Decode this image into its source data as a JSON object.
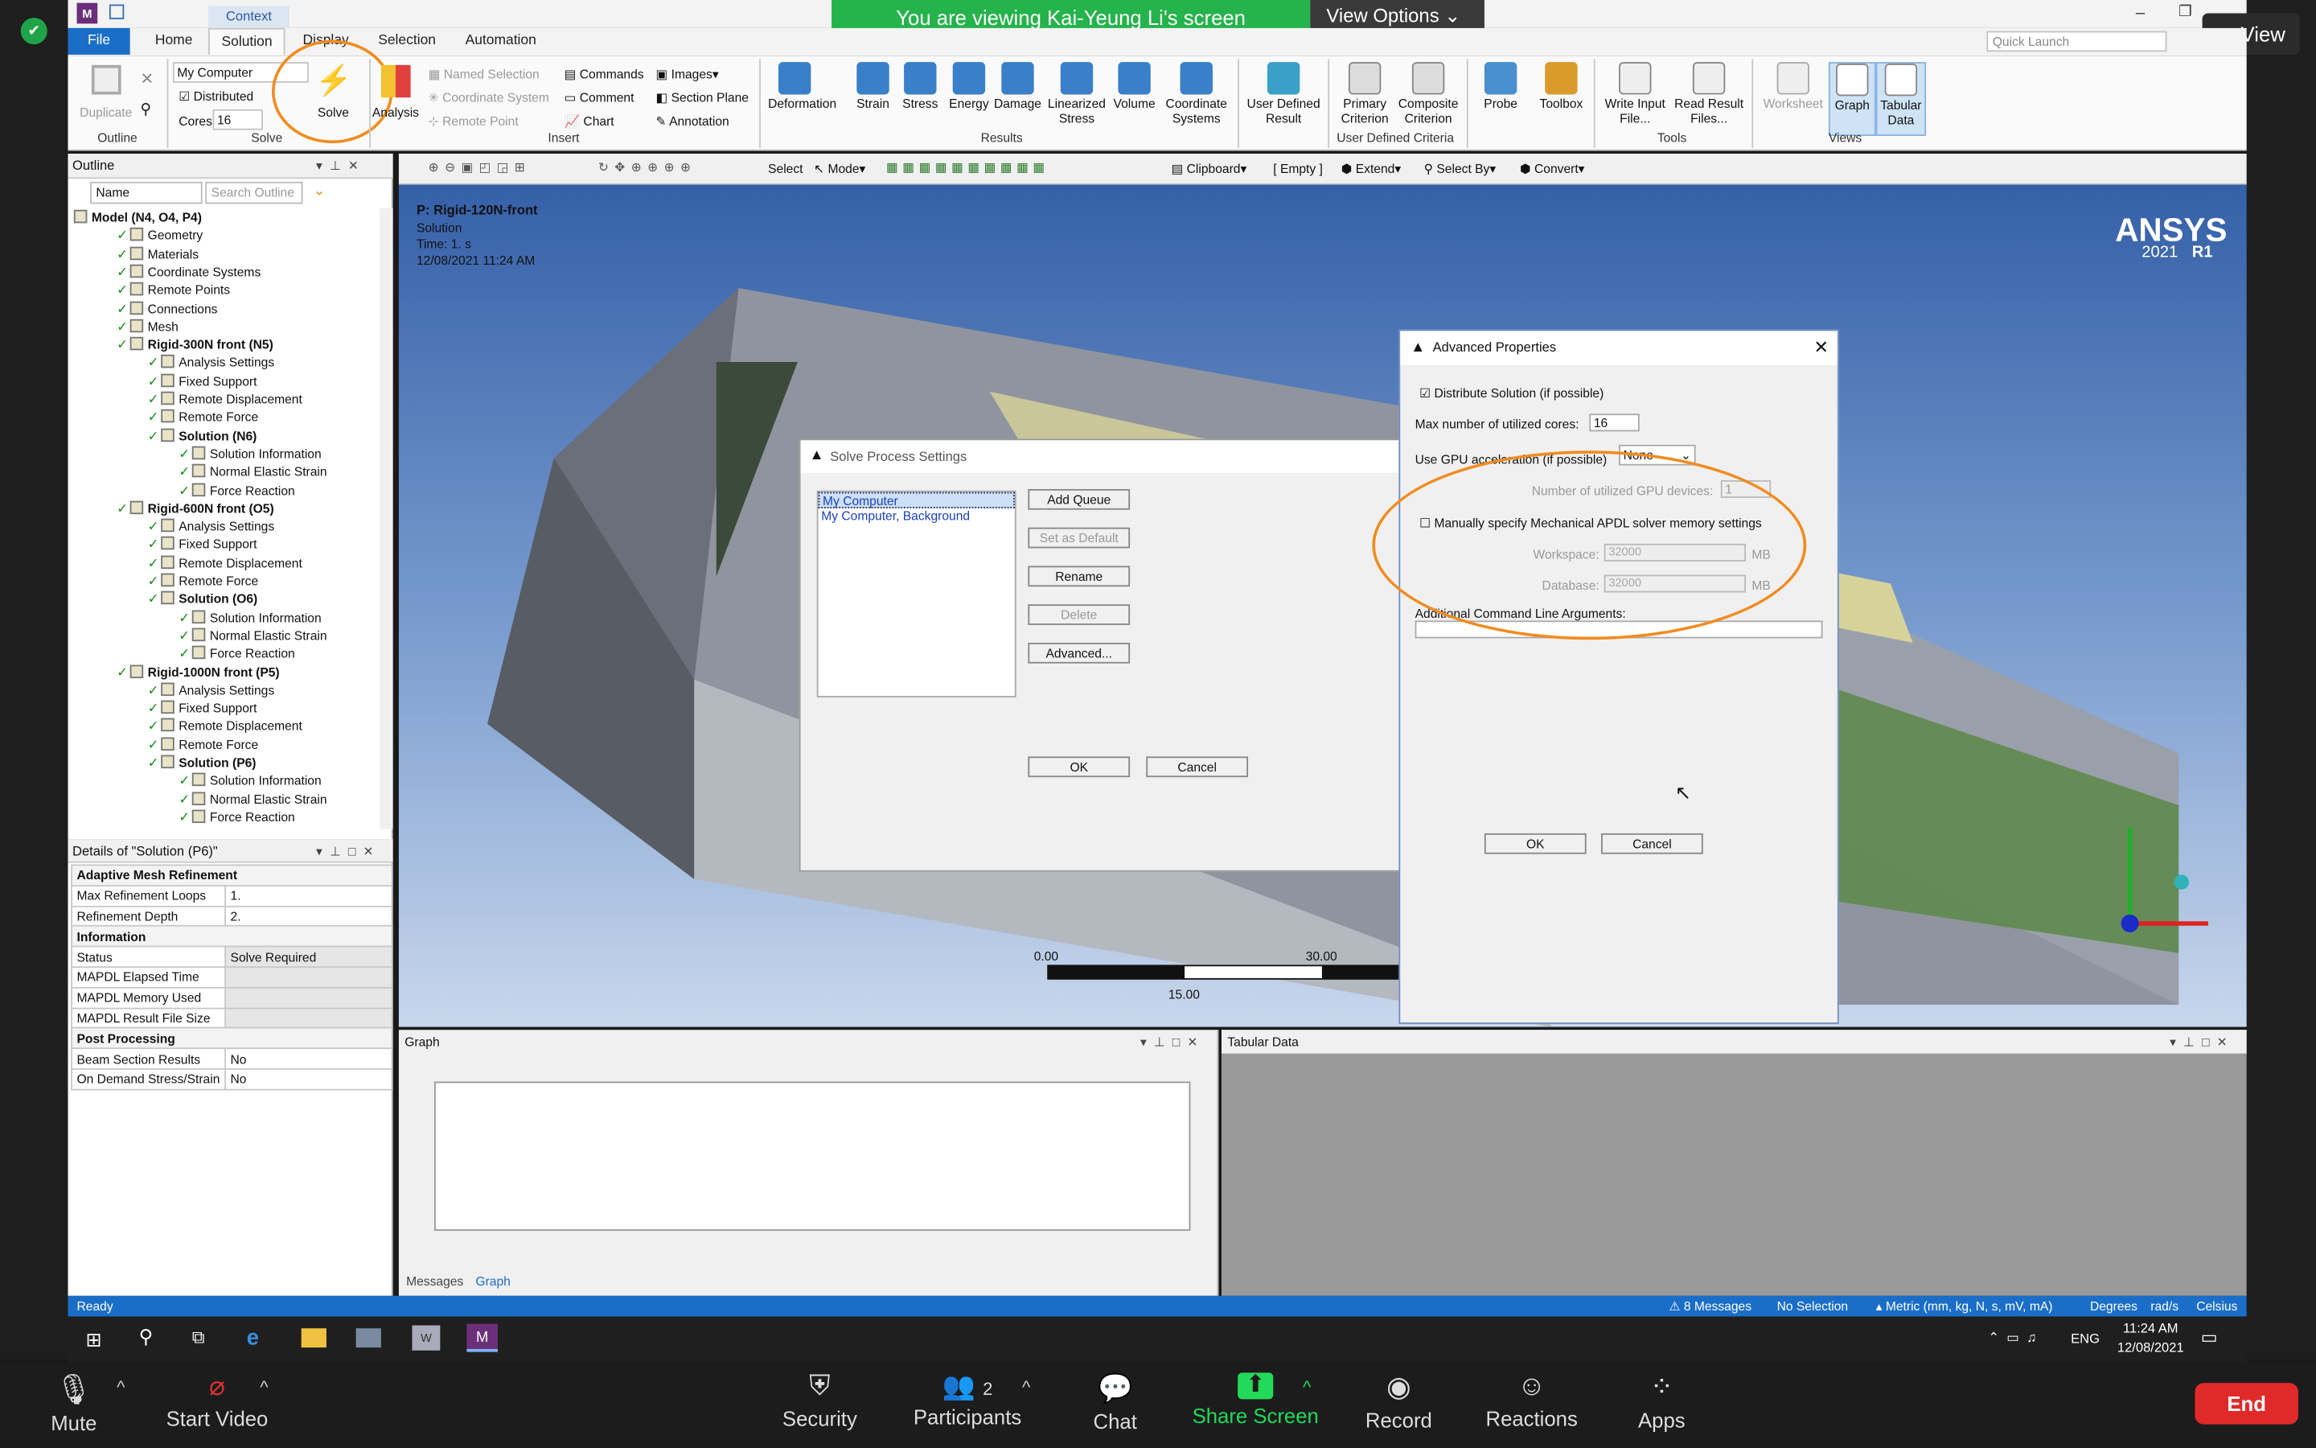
{
  "banner": {
    "text": "You are viewing Kai-Yeung Li's screen",
    "options": "View Options"
  },
  "view_button": "View",
  "ribbon": {
    "context_label": "Context",
    "tabs": [
      "File",
      "Home",
      "Solution",
      "Display",
      "Selection",
      "Automation"
    ],
    "quick_launch_placeholder": "Quick Launch",
    "outline": {
      "duplicate": "Duplicate",
      "group": "Outline"
    },
    "solve": {
      "computer": "My Computer",
      "distributed": "Distributed",
      "cores_label": "Cores",
      "cores": "16",
      "button": "Solve",
      "group": "Solve"
    },
    "insert": {
      "analysis": "Analysis",
      "named_selection": "Named Selection",
      "coordinate_system": "Coordinate System",
      "remote_point": "Remote Point",
      "commands": "Commands",
      "comment": "Comment",
      "chart": "Chart",
      "images": "Images",
      "section_plane": "Section Plane",
      "annotation": "Annotation",
      "group": "Insert"
    },
    "results": {
      "items": [
        "Deformation",
        "Strain",
        "Stress",
        "Energy",
        "Damage",
        "Linearized Stress",
        "Volume",
        "Coordinate Systems"
      ],
      "group": "Results"
    },
    "user_defined": {
      "label": "User Defined Result"
    },
    "criteria": {
      "primary": "Primary Criterion",
      "composite": "Composite Criterion",
      "group": "User Defined Criteria"
    },
    "probe": "Probe",
    "toolbox": "Toolbox",
    "tools": {
      "write": "Write Input File...",
      "read": "Read Result Files...",
      "group": "Tools"
    },
    "views": {
      "worksheet": "Worksheet",
      "graph": "Graph",
      "tabular": "Tabular Data",
      "group": "Views"
    }
  },
  "toolbar2": {
    "select": "Select",
    "mode": "Mode",
    "clipboard": "Clipboard",
    "empty": "[ Empty ]",
    "extend": "Extend",
    "select_by": "Select By",
    "convert": "Convert"
  },
  "outline": {
    "title": "Outline",
    "filter": "Name",
    "search_placeholder": "Search Outline",
    "items": [
      {
        "label": "Model (N4, O4, P4)",
        "bold": true,
        "indent": 0
      },
      {
        "label": "Geometry",
        "indent": 1
      },
      {
        "label": "Materials",
        "indent": 1
      },
      {
        "label": "Coordinate Systems",
        "indent": 1
      },
      {
        "label": "Remote Points",
        "indent": 1
      },
      {
        "label": "Connections",
        "indent": 1
      },
      {
        "label": "Mesh",
        "indent": 1
      },
      {
        "label": "Rigid-300N front (N5)",
        "bold": true,
        "indent": 1
      },
      {
        "label": "Analysis Settings",
        "indent": 2
      },
      {
        "label": "Fixed Support",
        "indent": 2
      },
      {
        "label": "Remote Displacement",
        "indent": 2
      },
      {
        "label": "Remote Force",
        "indent": 2
      },
      {
        "label": "Solution (N6)",
        "bold": true,
        "indent": 2
      },
      {
        "label": "Solution Information",
        "indent": 3
      },
      {
        "label": "Normal Elastic Strain",
        "indent": 3
      },
      {
        "label": "Force Reaction",
        "indent": 3
      },
      {
        "label": "Rigid-600N front (O5)",
        "bold": true,
        "indent": 1
      },
      {
        "label": "Analysis Settings",
        "indent": 2
      },
      {
        "label": "Fixed Support",
        "indent": 2
      },
      {
        "label": "Remote Displacement",
        "indent": 2
      },
      {
        "label": "Remote Force",
        "indent": 2
      },
      {
        "label": "Solution (O6)",
        "bold": true,
        "indent": 2
      },
      {
        "label": "Solution Information",
        "indent": 3
      },
      {
        "label": "Normal Elastic Strain",
        "indent": 3
      },
      {
        "label": "Force Reaction",
        "indent": 3
      },
      {
        "label": "Rigid-1000N front (P5)",
        "bold": true,
        "indent": 1
      },
      {
        "label": "Analysis Settings",
        "indent": 2
      },
      {
        "label": "Fixed Support",
        "indent": 2
      },
      {
        "label": "Remote Displacement",
        "indent": 2
      },
      {
        "label": "Remote Force",
        "indent": 2
      },
      {
        "label": "Solution (P6)",
        "bold": true,
        "indent": 2
      },
      {
        "label": "Solution Information",
        "indent": 3
      },
      {
        "label": "Normal Elastic Strain",
        "indent": 3
      },
      {
        "label": "Force Reaction",
        "indent": 3
      }
    ]
  },
  "details": {
    "title": "Details of \"Solution (P6)\"",
    "rows": [
      {
        "section": "Adaptive Mesh Refinement"
      },
      {
        "k": "Max Refinement Loops",
        "v": "1."
      },
      {
        "k": "Refinement Depth",
        "v": "2."
      },
      {
        "section": "Information"
      },
      {
        "k": "Status",
        "v": "Solve Required"
      },
      {
        "k": "MAPDL Elapsed Time",
        "v": ""
      },
      {
        "k": "MAPDL Memory Used",
        "v": ""
      },
      {
        "k": "MAPDL Result File Size",
        "v": ""
      },
      {
        "section": "Post Processing"
      },
      {
        "k": "Beam Section Results",
        "v": "No"
      },
      {
        "k": "On Demand Stress/Strain",
        "v": "No"
      }
    ]
  },
  "viewport": {
    "title": "P: Rigid-120N-front",
    "sub": "Solution",
    "time": "Time: 1. s",
    "date": "12/08/2021 11:24 AM",
    "logo": "ANSYS",
    "version": "2021",
    "release": "R1",
    "scale": [
      "0.00",
      "30.00",
      "15.00"
    ]
  },
  "solve_dialog": {
    "title": "Solve Process Settings",
    "list": [
      "My Computer",
      "My Computer, Background"
    ],
    "buttons": [
      "Add Queue",
      "Set as Default",
      "Rename",
      "Delete",
      "Advanced..."
    ],
    "ok": "OK",
    "cancel": "Cancel"
  },
  "advanced": {
    "title": "Advanced Properties",
    "distribute": "Distribute Solution (if possible)",
    "max_cores_label": "Max number of utilized cores:",
    "max_cores": "16",
    "gpu_label": "Use GPU acceleration (if possible)",
    "gpu_value": "None",
    "gpu_devices_label": "Number of utilized GPU devices:",
    "gpu_devices": "1",
    "manual_mem": "Manually specify Mechanical APDL solver memory settings",
    "workspace_label": "Workspace:",
    "workspace": "32000",
    "database_label": "Database:",
    "database": "32000",
    "mb": "MB",
    "args_label": "Additional Command Line Arguments:",
    "ok": "OK",
    "cancel": "Cancel"
  },
  "graph_panel": {
    "title": "Graph",
    "tabs": [
      "Messages",
      "Graph"
    ]
  },
  "tabular_panel": {
    "title": "Tabular Data"
  },
  "statusbar": {
    "ready": "Ready",
    "messages": "8 Messages",
    "selection": "No Selection",
    "units": "Metric (mm, kg, N, s, mV, mA)",
    "degrees": "Degrees",
    "rad": "rad/s",
    "temp": "Celsius"
  },
  "taskbar": {
    "lang": "ENG",
    "time": "11:24 AM",
    "date": "12/08/2021"
  },
  "zoom": {
    "mute": "Mute",
    "video": "Start Video",
    "security": "Security",
    "participants": "Participants",
    "participants_count": "2",
    "chat": "Chat",
    "share": "Share Screen",
    "record": "Record",
    "reactions": "Reactions",
    "apps": "Apps",
    "end": "End"
  },
  "colors": {
    "accent": "#0078d7",
    "highlight": "#f08c20",
    "zoom_bar": "#1c1c1c",
    "end": "#e02a2a",
    "share": "#23d959"
  }
}
